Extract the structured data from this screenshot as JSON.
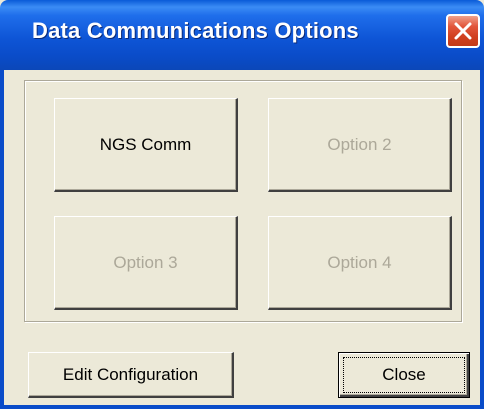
{
  "window": {
    "title": "Data Communications Options",
    "accent": "#0A4CC9",
    "close_color": "#D0401F"
  },
  "options": {
    "option1_label": "NGS Comm",
    "option2_label": "Option 2",
    "option3_label": "Option 3",
    "option4_label": "Option 4"
  },
  "footer": {
    "edit_label": "Edit Configuration",
    "close_label": "Close"
  },
  "icons": {
    "title_close": "close-icon"
  }
}
